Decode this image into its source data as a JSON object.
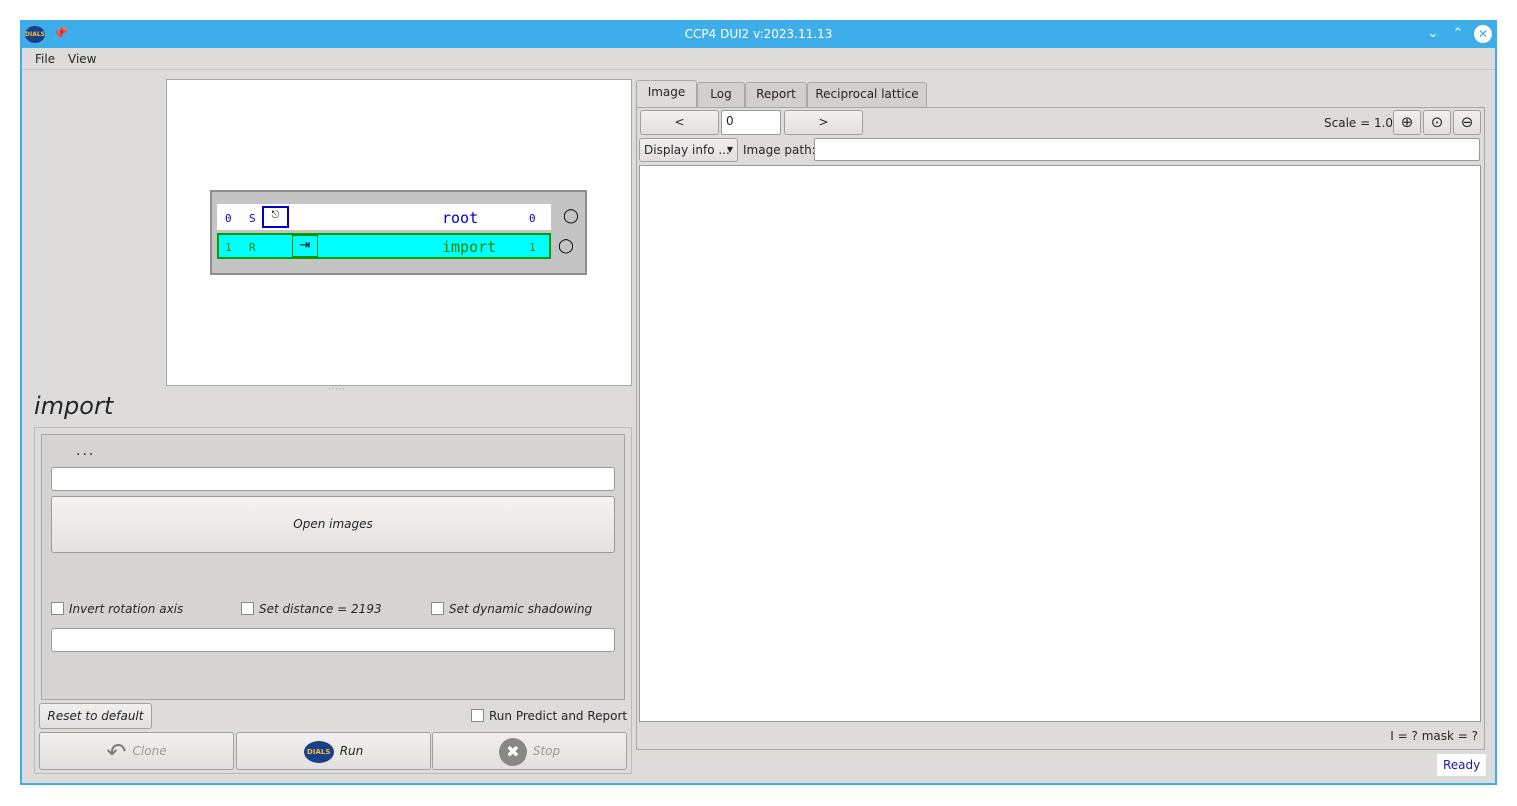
{
  "window": {
    "title": "CCP4 DUI2 v:2023.11.13",
    "app_icon": "DIALS"
  },
  "menu": {
    "file": "File",
    "view": "View"
  },
  "tree": {
    "rows": [
      {
        "num": "0",
        "flag": "S",
        "label": "root",
        "count": "0"
      },
      {
        "num": "1",
        "flag": "R",
        "label": "import",
        "count": "1"
      }
    ]
  },
  "step": {
    "title": "import",
    "dots": "...",
    "open_images": "Open images",
    "invert_rotation": "Invert rotation axis",
    "set_distance": "Set distance = 2193",
    "dynamic_shadowing": "Set dynamic shadowing",
    "reset": "Reset to default",
    "run_predict": "Run Predict and Report",
    "clone": "Clone",
    "run": "Run",
    "run_icon": "DIALS",
    "stop": "Stop"
  },
  "tabs": [
    "Image",
    "Log",
    "Report",
    "Reciprocal lattice"
  ],
  "image_panel": {
    "prev": "<",
    "next": ">",
    "image_num": "0",
    "scale": "Scale = 1.00",
    "display_info": "Display info ...",
    "image_path_label": "Image path:",
    "pixel_info": "I = ?  mask = ?"
  },
  "status": "Ready",
  "colors": {
    "accent": "#3daee9",
    "selected_node": "#00ffff",
    "node_green": "#00a000",
    "root_blue": "#0000c8"
  }
}
